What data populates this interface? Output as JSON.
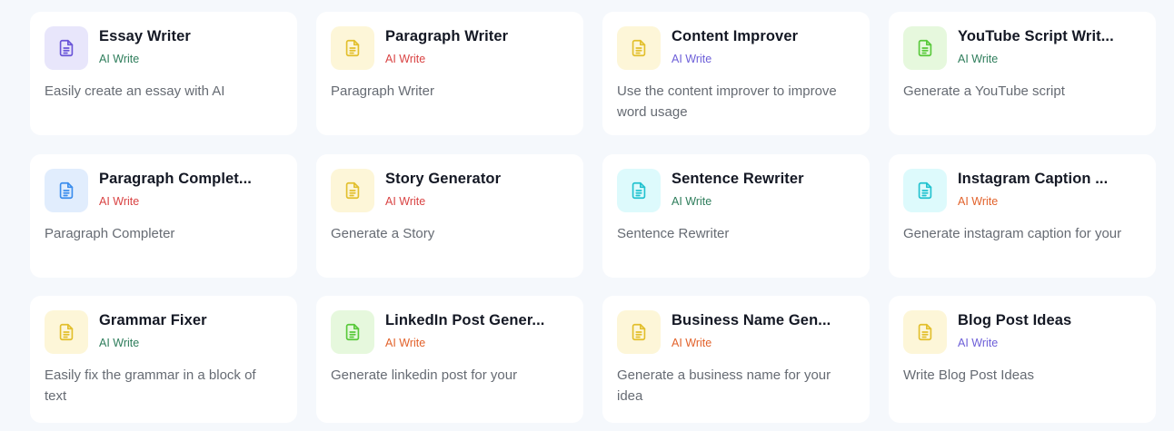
{
  "cards": [
    {
      "title": "Essay Writer",
      "tag": "AI Write",
      "description": "Easily create an essay with AI",
      "icon": "document-icon",
      "icon_bg": "#e8e6fb",
      "icon_color": "#6a55d8",
      "tag_color": "#2e7d5b"
    },
    {
      "title": "Paragraph Writer",
      "tag": "AI Write",
      "description": "Paragraph Writer",
      "icon": "document-icon",
      "icon_bg": "#fdf6d8",
      "icon_color": "#e2bf2c",
      "tag_color": "#d94343"
    },
    {
      "title": "Content Improver",
      "tag": "AI Write",
      "description": "Use the content improver to improve word usage",
      "icon": "document-icon",
      "icon_bg": "#fdf6d8",
      "icon_color": "#e2bf2c",
      "tag_color": "#6c5ed8"
    },
    {
      "title": "YouTube Script Writ...",
      "tag": "AI Write",
      "description": "Generate a YouTube script",
      "icon": "document-icon",
      "icon_bg": "#e6f8dd",
      "icon_color": "#58c93a",
      "tag_color": "#2e7d5b"
    },
    {
      "title": "Paragraph Complet...",
      "tag": "AI Write",
      "description": "Paragraph Completer",
      "icon": "document-icon",
      "icon_bg": "#e1edfd",
      "icon_color": "#3b8ded",
      "tag_color": "#d94343"
    },
    {
      "title": "Story Generator",
      "tag": "AI Write",
      "description": "Generate a Story",
      "icon": "document-icon",
      "icon_bg": "#fdf6d8",
      "icon_color": "#e2bf2c",
      "tag_color": "#d94343"
    },
    {
      "title": "Sentence Rewriter",
      "tag": "AI Write",
      "description": "Sentence Rewriter",
      "icon": "document-icon",
      "icon_bg": "#ddfafc",
      "icon_color": "#21c2cf",
      "tag_color": "#2e7d5b"
    },
    {
      "title": "Instagram Caption ...",
      "tag": "AI Write",
      "description": "Generate instagram caption for your",
      "icon": "document-icon",
      "icon_bg": "#ddfafc",
      "icon_color": "#21c2cf",
      "tag_color": "#e2622b"
    },
    {
      "title": "Grammar Fixer",
      "tag": "AI Write",
      "description": "Easily fix the grammar in a block of text",
      "icon": "document-icon",
      "icon_bg": "#fdf6d8",
      "icon_color": "#e2bf2c",
      "tag_color": "#2e7d5b"
    },
    {
      "title": "LinkedIn Post Gener...",
      "tag": "AI Write",
      "description": "Generate linkedin post for your",
      "icon": "document-icon",
      "icon_bg": "#e6f8dd",
      "icon_color": "#58c93a",
      "tag_color": "#e2622b"
    },
    {
      "title": "Business Name Gen...",
      "tag": "AI Write",
      "description": "Generate a business name for your idea",
      "icon": "document-icon",
      "icon_bg": "#fdf6d8",
      "icon_color": "#e2bf2c",
      "tag_color": "#e2622b"
    },
    {
      "title": "Blog Post Ideas",
      "tag": "AI Write",
      "description": "Write Blog Post Ideas",
      "icon": "document-icon",
      "icon_bg": "#fdf6d8",
      "icon_color": "#e2bf2c",
      "tag_color": "#6c5ed8"
    }
  ]
}
